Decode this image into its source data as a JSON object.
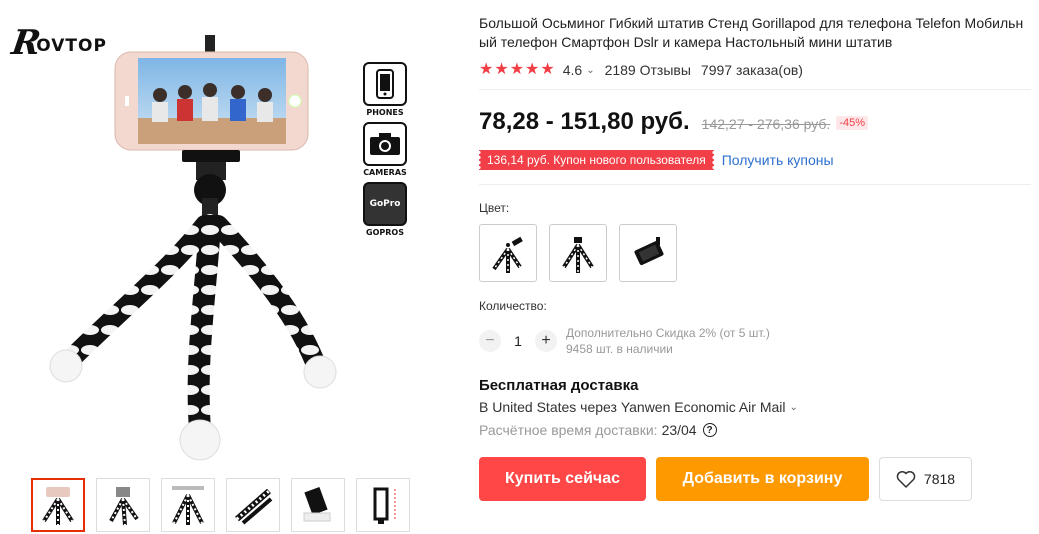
{
  "brand": {
    "logo_text": "ROVTOP",
    "mark": "R",
    "rest": "OVTOP"
  },
  "badges": [
    {
      "label": "PHONES",
      "icon": "phone-icon"
    },
    {
      "label": "CAMERAS",
      "icon": "camera-icon"
    },
    {
      "label": "GOPROS",
      "icon": "gopro-icon",
      "icon_text": "GoPro"
    }
  ],
  "thumbnails": [
    {
      "icon": "tripod-with-phone-thumbnail",
      "active": true
    },
    {
      "icon": "tripod-with-gopro-thumbnail",
      "active": false
    },
    {
      "icon": "tripod-bendable-thumbnail",
      "active": false
    },
    {
      "icon": "tripod-wrapped-thumbnail",
      "active": false
    },
    {
      "icon": "phone-clamp-thumbnail",
      "active": false
    },
    {
      "icon": "clamp-dimensions-thumbnail",
      "active": false
    }
  ],
  "product": {
    "title": "Большой Осьминог Гибкий штатив Стенд Gorillapod для телефона Telefon Мобильный телефон Смартфон Dslr и камера Настольный мини штатив",
    "rating": "4.6",
    "reviews": "2189 Отзывы",
    "orders": "7997 заказа(ов)",
    "stars": 5
  },
  "price": {
    "current": "78,28 - 151,80 руб.",
    "old": "142,27 - 276,36 руб.",
    "discount": "-45%"
  },
  "coupon": {
    "text": "136,14 руб. Купон нового пользователя",
    "link": "Получить купоны"
  },
  "variants": {
    "label": "Цвет:",
    "items": [
      "tripod-with-clamp-variant",
      "tripod-only-variant",
      "phone-clamp-variant"
    ]
  },
  "quantity": {
    "label": "Количество:",
    "minus": "−",
    "value": "1",
    "plus": "+",
    "discount_note": "Дополнительно Скидка 2% (от 5 шт.)",
    "stock": "9458 шт. в наличии"
  },
  "shipping": {
    "title": "Бесплатная доставка",
    "route": "В United States через Yanwen Economic Air Mail",
    "eta_label": "Расчётное время доставки:",
    "eta_value": "23/04"
  },
  "actions": {
    "buy": "Купить сейчас",
    "cart": "Добавить в корзину",
    "wishlist_count": "7818"
  },
  "colors": {
    "accent_red": "#ff4747",
    "star_red": "#f13e47",
    "orange": "#ff9900",
    "link_blue": "#2e6fcf"
  }
}
